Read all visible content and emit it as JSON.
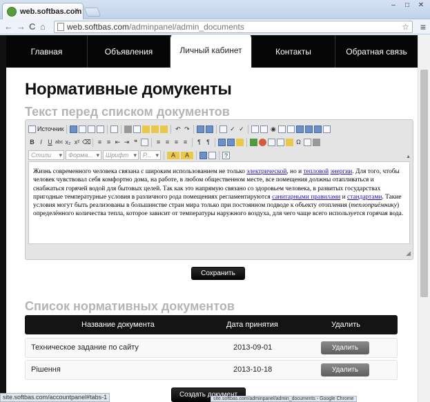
{
  "browser": {
    "tab_title": "web.softbas.com",
    "tab_close": "×",
    "back": "←",
    "forward": "→",
    "reload": "C",
    "home": "⌂",
    "url_host": "web.softbas.com",
    "url_path": "/adminpanel/admin_documents",
    "star": "☆",
    "menu": "≡",
    "win_min": "–",
    "win_max": "□",
    "win_close": "✕",
    "status_left": "site.softbas.com/accountpanel#tabs-1",
    "status_right": "site.softbas.com/adminpanel/admin_documents - Google Chrome"
  },
  "nav": {
    "items": [
      "Главная",
      "Объявления",
      "Личный кабинет",
      "Контакты",
      "Обратная связь"
    ]
  },
  "page": {
    "title": "Нормативные домукенты",
    "section1": "Текст перед списком документов",
    "section2": "Список нормативных документов"
  },
  "editor": {
    "source_label": "Источник",
    "combo_styles": "Стили",
    "combo_format": "Форма...",
    "combo_font": "Шрифт",
    "combo_size": "Р...",
    "text_parts": {
      "p1": "Жизнь современного человека связана с широким использованием не только ",
      "l1": "электрической",
      "p2": ", но и ",
      "l2": "тепловой",
      "p3": " ",
      "l3": "энергии",
      "p4": ". Для того, чтобы человек чувствовал себя комфортно дома, на работе, в любом общественном месте, все помещения должны отапливаться и снабжаться горячей водой для бытовых целей. Так как это напрямую связано со здоровьем человека, в развитых государствах пригодные температурные условия в различного рода помещениях регламентируются ",
      "l4": "санитарными правилами",
      "p5": " и ",
      "l5": "стандартами",
      "p6": ". Такие условия могут быть реализованы в большинстве стран мира только при постоянном подводе к объекту отопления (",
      "em": "теплоприёмнику",
      "p7": ") определённого количества тепла, которое зависит от температуры наружного воздуха, для чего чаще всего используется горячая вода."
    }
  },
  "buttons": {
    "save": "Сохранить",
    "create": "Создать документ"
  },
  "table": {
    "headers": [
      "Название документа",
      "Дата принятия",
      "Удалить"
    ],
    "rows": [
      {
        "name": "Техническое задание по сайту",
        "date": "2013-09-01",
        "action": "Удалить"
      },
      {
        "name": "Рішення",
        "date": "2013-10-18",
        "action": "Удалить"
      }
    ]
  }
}
